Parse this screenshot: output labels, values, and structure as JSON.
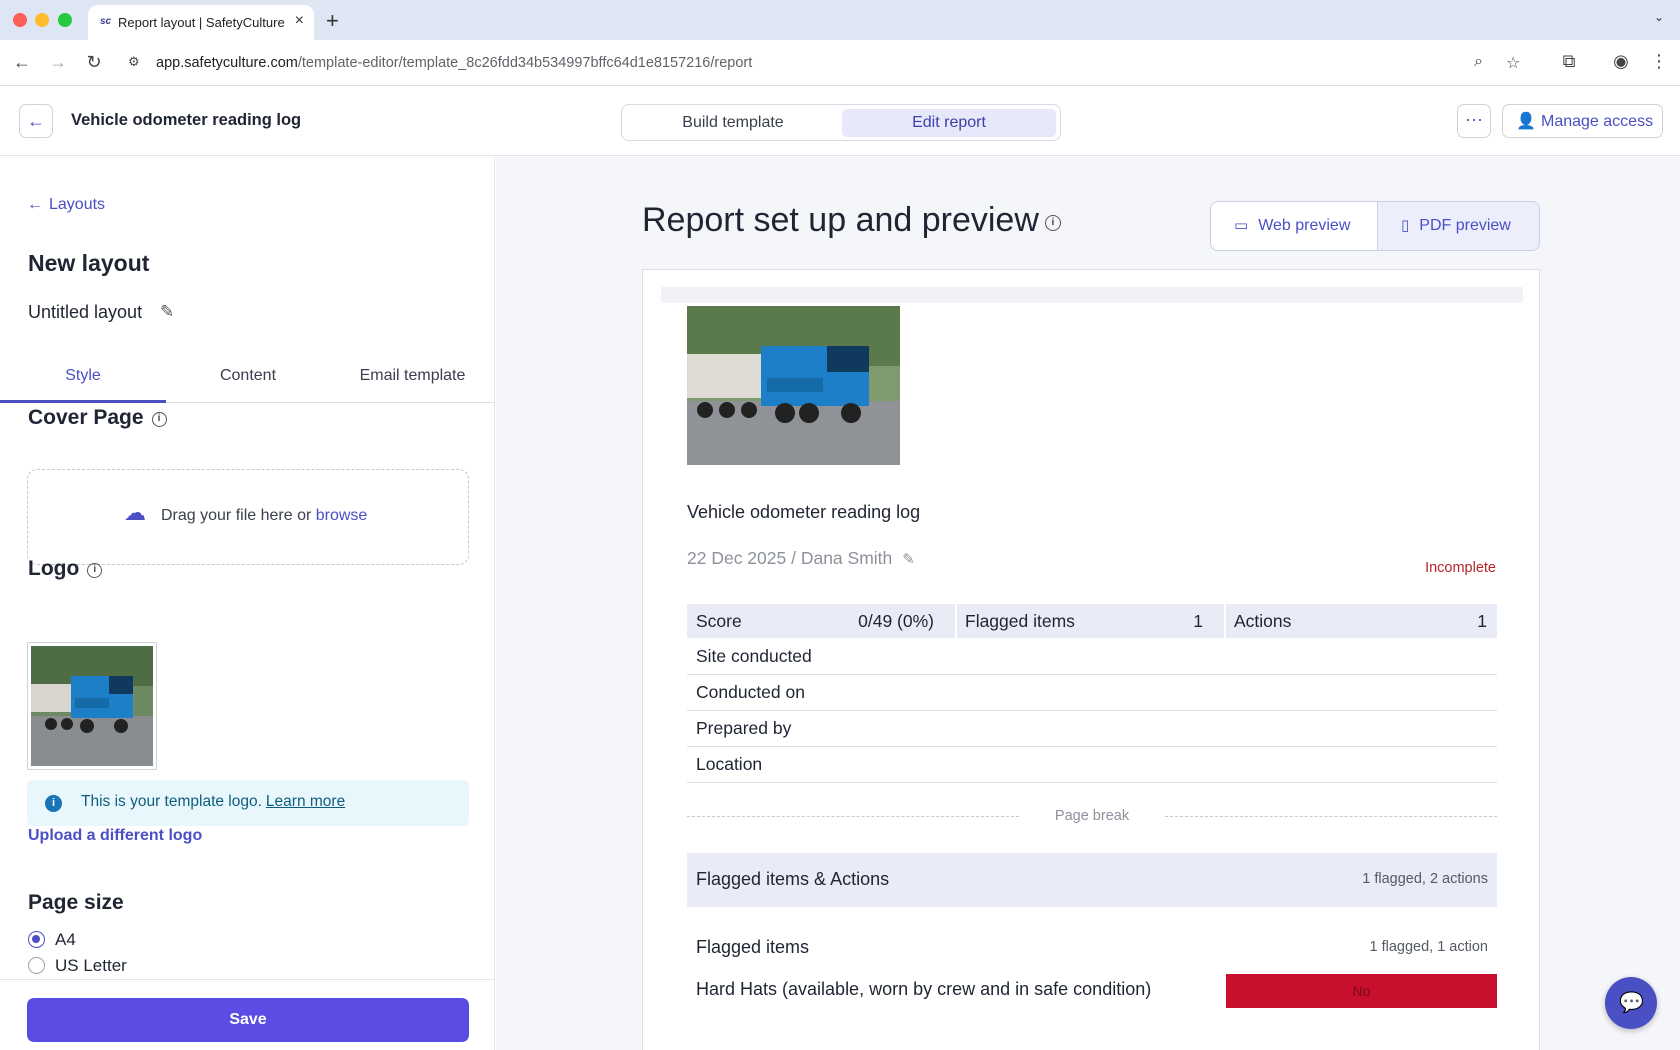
{
  "browser": {
    "tab_title": "Report layout | SafetyCulture",
    "tab_favicon": "sc",
    "url_domain": "app.safetyculture.com",
    "url_path": "/template-editor/template_8c26fdd34b534997bffc64d1e8157216/report"
  },
  "header": {
    "template_name": "Vehicle odometer reading log",
    "build_template": "Build template",
    "edit_report": "Edit report",
    "manage_access": "Manage access"
  },
  "left": {
    "layouts_link": "Layouts",
    "new_layout": "New layout",
    "layout_name": "Untitled layout",
    "tabs": {
      "style": "Style",
      "content": "Content",
      "email": "Email template"
    },
    "cover_page": {
      "title": "Cover Page",
      "drag_text": "Drag your file here or",
      "browse": "browse"
    },
    "logo": {
      "title": "Logo",
      "info_text": "This is your template logo.",
      "learn_more": "Learn more",
      "upload_link": "Upload a different logo"
    },
    "page_size": {
      "title": "Page size",
      "options": [
        "A4",
        "US Letter"
      ],
      "selected": "A4"
    },
    "save": "Save"
  },
  "right": {
    "title": "Report set up and preview",
    "web_preview": "Web preview",
    "pdf_preview": "PDF preview",
    "doc": {
      "title": "Vehicle odometer reading log",
      "meta": "22 Dec 2025 / Dana Smith",
      "status": "Incomplete",
      "summary": {
        "score_label": "Score",
        "score_value": "0/49 (0%)",
        "flagged_label": "Flagged items",
        "flagged_value": "1",
        "actions_label": "Actions",
        "actions_value": "1"
      },
      "fields": [
        "Site conducted",
        "Conducted on",
        "Prepared by",
        "Location"
      ],
      "page_break": "Page break",
      "flagged_actions": {
        "title": "Flagged items & Actions",
        "count": "1 flagged, 2 actions"
      },
      "flagged_items": {
        "title": "Flagged items",
        "count": "1 flagged, 1 action"
      },
      "question": {
        "label": "Hard Hats (available, worn by crew and in safe condition)",
        "answer": "No"
      }
    }
  },
  "colors": {
    "accent": "#4a4fc4",
    "save": "#5b4ce3",
    "status_incomplete": "#b5262c",
    "answer_no": "#c8102e"
  }
}
